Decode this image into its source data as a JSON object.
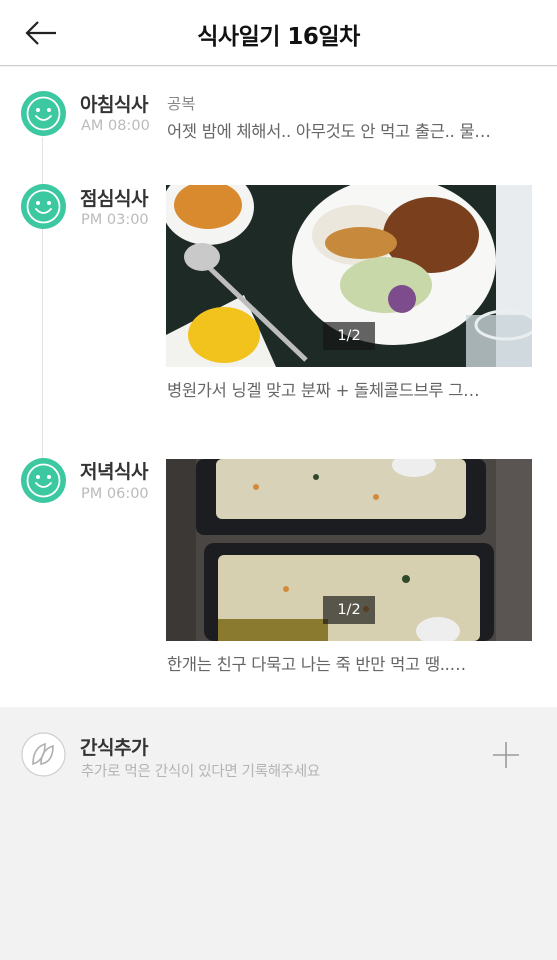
{
  "header": {
    "title": "식사일기 16일차",
    "back_icon": "back-arrow-icon"
  },
  "colors": {
    "accent": "#3cc8a0",
    "background": "#f2f2f2"
  },
  "meals": [
    {
      "name": "아침식사",
      "time": "AM 08:00",
      "tag": "공복",
      "description": "어젯 밤에 체해서.. 아무것도 안 먹고 출근.. 물…",
      "icon": "smiley-icon"
    },
    {
      "name": "점심식사",
      "time": "PM 03:00",
      "photo_counter": "1/2",
      "description": "병원가서 닝겔 맞고 분짜 + 돌체콜드브루 그…",
      "icon": "smiley-icon"
    },
    {
      "name": "저녁식사",
      "time": "PM 06:00",
      "photo_counter": "1/2",
      "description": "한개는 친구 다묵고 나는 죽 반만 먹고 땡..…",
      "icon": "smiley-icon"
    }
  ],
  "snack": {
    "title": "간식추가",
    "subtitle": "추가로 먹은 간식이 있다면 기록해주세요",
    "icon": "leaf-icon",
    "add_icon": "plus-icon"
  }
}
